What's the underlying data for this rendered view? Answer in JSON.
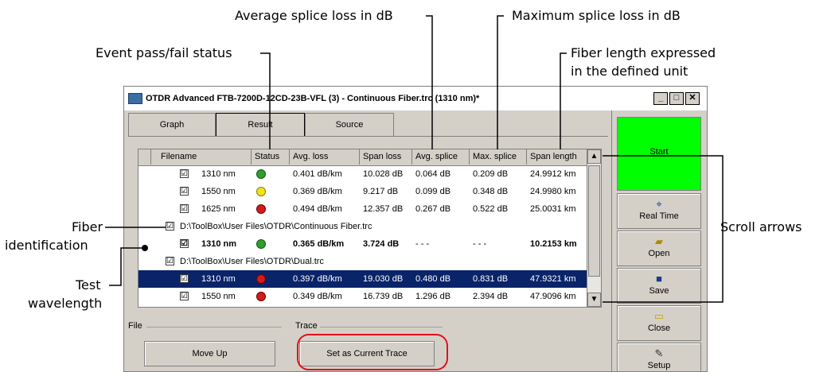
{
  "callouts": {
    "avg_splice": "Average splice loss in dB",
    "max_splice": "Maximum splice loss in dB",
    "event_status": "Event pass/fail status",
    "fiber_length": "Fiber length expressed",
    "fiber_length_2": "in the defined unit",
    "fiber_id": "Fiber",
    "fiber_id_2": "identification",
    "scroll_arrows": "Scroll arrows",
    "test_wl": "Test",
    "test_wl_2": "wavelength"
  },
  "window": {
    "title": "OTDR Advanced FTB-7200D-12CD-23B-VFL (3) - Continuous Fiber.trc (1310 nm)*",
    "minimize": "_",
    "maximize": "□",
    "close": "✕"
  },
  "tabs": [
    {
      "label": "Graph"
    },
    {
      "label": "Result"
    },
    {
      "label": "Source"
    }
  ],
  "table": {
    "columns": [
      "Filename",
      "Status",
      "Avg. loss",
      "Span loss",
      "Avg. splice",
      "Max. splice",
      "Span length"
    ],
    "rows": [
      {
        "check": "☑",
        "name": "1310 nm",
        "status": "pass",
        "avg_loss": "0.401 dB/km",
        "span_loss": "10.028 dB",
        "avg_splice": "0.064 dB",
        "max_splice": "0.209 dB",
        "span_length": "24.9912 km"
      },
      {
        "check": "☑",
        "name": "1550 nm",
        "status": "warning",
        "avg_loss": "0.369 dB/km",
        "span_loss": "9.217 dB",
        "avg_splice": "0.099 dB",
        "max_splice": "0.348 dB",
        "span_length": "24.9980 km"
      },
      {
        "check": "☑",
        "name": "1625 nm",
        "status": "fail",
        "avg_loss": "0.494 dB/km",
        "span_loss": "12.357 dB",
        "avg_splice": "0.267 dB",
        "max_splice": "0.522 dB",
        "span_length": "25.0031 km"
      },
      {
        "check": "☑",
        "name": "D:\\ToolBox\\User Files\\OTDR\\Continuous Fiber.trc"
      },
      {
        "check": "☑",
        "name": "1310 nm",
        "status": "pass",
        "avg_loss": "0.365 dB/km",
        "span_loss": "3.724 dB",
        "avg_splice": "- - -",
        "max_splice": "- - -",
        "span_length": "10.2153 km"
      },
      {
        "check": "☑",
        "name": "D:\\ToolBox\\User Files\\OTDR\\Dual.trc"
      },
      {
        "check": "☑",
        "name": "1310 nm",
        "status": "fail",
        "avg_loss": "0.397 dB/km",
        "span_loss": "19.030 dB",
        "avg_splice": "0.480 dB",
        "max_splice": "0.831 dB",
        "span_length": "47.9321 km"
      },
      {
        "check": "☑",
        "name": "1550 nm",
        "status": "fail",
        "avg_loss": "0.349 dB/km",
        "span_loss": "16.739 dB",
        "avg_splice": "1.296 dB",
        "max_splice": "2.394 dB",
        "span_length": "47.9096 km"
      }
    ],
    "scroll_up": "▲",
    "scroll_down": "▼"
  },
  "groups": {
    "file_label": "File",
    "trace_label": "Trace",
    "move_up": "Move Up",
    "set_current": "Set as Current Trace"
  },
  "side": {
    "start": "Start",
    "realtime": "Real Time",
    "open": "Open",
    "save": "Save",
    "close": "Close",
    "setup": "Setup"
  },
  "colors": {
    "pass": "#2e9e2e",
    "warning": "#f2e21a",
    "fail": "#d21b1b",
    "start_bg": "#00ff00",
    "selected_row": "#0a246a",
    "highlight_ring": "#e0101a"
  }
}
